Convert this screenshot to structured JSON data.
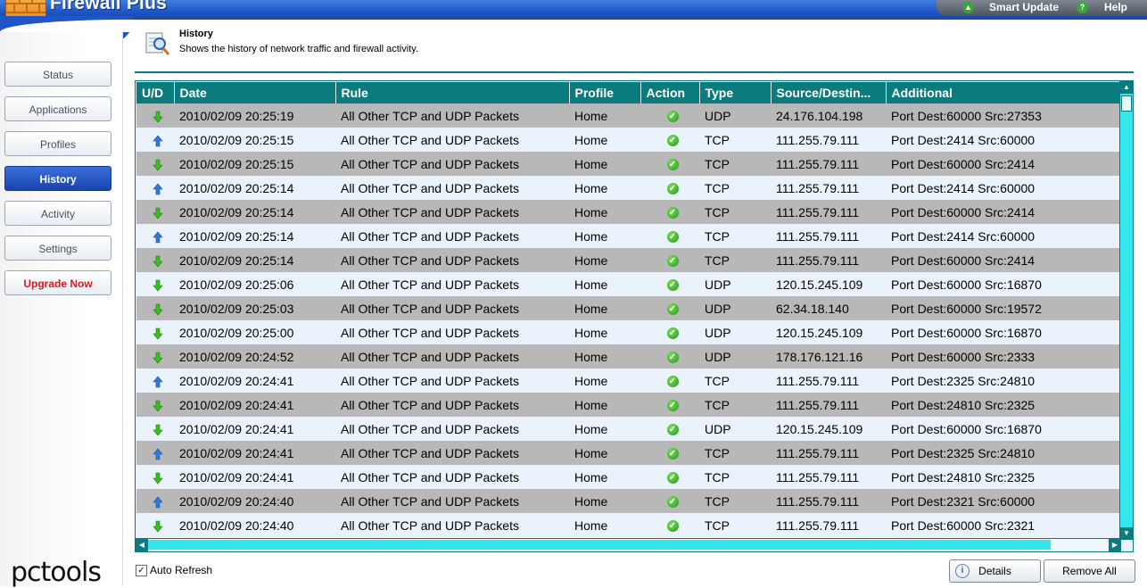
{
  "app": {
    "title": "Firewall Plus"
  },
  "topbar": {
    "smart_update": "Smart Update",
    "help": "Help"
  },
  "sidebar": {
    "items": [
      {
        "label": "Status"
      },
      {
        "label": "Applications"
      },
      {
        "label": "Profiles"
      },
      {
        "label": "History"
      },
      {
        "label": "Activity"
      },
      {
        "label": "Settings"
      },
      {
        "label": "Upgrade Now"
      }
    ],
    "active": "History",
    "brand": "pctools"
  },
  "header": {
    "title": "History",
    "subtitle": "Shows the history of network traffic and firewall activity."
  },
  "table": {
    "columns": [
      "U/D",
      "Date",
      "Rule",
      "Profile",
      "Action",
      "Type",
      "Source/Destin...",
      "Additional"
    ],
    "rows": [
      {
        "dir": "down",
        "date": "2010/02/09 20:25:19",
        "rule": "All Other TCP and UDP Packets",
        "profile": "Home",
        "type": "UDP",
        "addr": "24.176.104.198",
        "additional": "Port Dest:60000 Src:27353"
      },
      {
        "dir": "up",
        "date": "2010/02/09 20:25:15",
        "rule": "All Other TCP and UDP Packets",
        "profile": "Home",
        "type": "TCP",
        "addr": "111.255.79.111",
        "additional": "Port Dest:2414 Src:60000"
      },
      {
        "dir": "down",
        "date": "2010/02/09 20:25:15",
        "rule": "All Other TCP and UDP Packets",
        "profile": "Home",
        "type": "TCP",
        "addr": "111.255.79.111",
        "additional": "Port Dest:60000 Src:2414"
      },
      {
        "dir": "up",
        "date": "2010/02/09 20:25:14",
        "rule": "All Other TCP and UDP Packets",
        "profile": "Home",
        "type": "TCP",
        "addr": "111.255.79.111",
        "additional": "Port Dest:2414 Src:60000"
      },
      {
        "dir": "down",
        "date": "2010/02/09 20:25:14",
        "rule": "All Other TCP and UDP Packets",
        "profile": "Home",
        "type": "TCP",
        "addr": "111.255.79.111",
        "additional": "Port Dest:60000 Src:2414"
      },
      {
        "dir": "up",
        "date": "2010/02/09 20:25:14",
        "rule": "All Other TCP and UDP Packets",
        "profile": "Home",
        "type": "TCP",
        "addr": "111.255.79.111",
        "additional": "Port Dest:2414 Src:60000"
      },
      {
        "dir": "down",
        "date": "2010/02/09 20:25:14",
        "rule": "All Other TCP and UDP Packets",
        "profile": "Home",
        "type": "TCP",
        "addr": "111.255.79.111",
        "additional": "Port Dest:60000 Src:2414"
      },
      {
        "dir": "down",
        "date": "2010/02/09 20:25:06",
        "rule": "All Other TCP and UDP Packets",
        "profile": "Home",
        "type": "UDP",
        "addr": "120.15.245.109",
        "additional": "Port Dest:60000 Src:16870"
      },
      {
        "dir": "down",
        "date": "2010/02/09 20:25:03",
        "rule": "All Other TCP and UDP Packets",
        "profile": "Home",
        "type": "UDP",
        "addr": "62.34.18.140",
        "additional": "Port Dest:60000 Src:19572"
      },
      {
        "dir": "down",
        "date": "2010/02/09 20:25:00",
        "rule": "All Other TCP and UDP Packets",
        "profile": "Home",
        "type": "UDP",
        "addr": "120.15.245.109",
        "additional": "Port Dest:60000 Src:16870"
      },
      {
        "dir": "down",
        "date": "2010/02/09 20:24:52",
        "rule": "All Other TCP and UDP Packets",
        "profile": "Home",
        "type": "UDP",
        "addr": "178.176.121.16",
        "additional": "Port Dest:60000 Src:2333"
      },
      {
        "dir": "up",
        "date": "2010/02/09 20:24:41",
        "rule": "All Other TCP and UDP Packets",
        "profile": "Home",
        "type": "TCP",
        "addr": "111.255.79.111",
        "additional": "Port Dest:2325 Src:24810"
      },
      {
        "dir": "down",
        "date": "2010/02/09 20:24:41",
        "rule": "All Other TCP and UDP Packets",
        "profile": "Home",
        "type": "TCP",
        "addr": "111.255.79.111",
        "additional": "Port Dest:24810 Src:2325"
      },
      {
        "dir": "down",
        "date": "2010/02/09 20:24:41",
        "rule": "All Other TCP and UDP Packets",
        "profile": "Home",
        "type": "UDP",
        "addr": "120.15.245.109",
        "additional": "Port Dest:60000 Src:16870"
      },
      {
        "dir": "up",
        "date": "2010/02/09 20:24:41",
        "rule": "All Other TCP and UDP Packets",
        "profile": "Home",
        "type": "TCP",
        "addr": "111.255.79.111",
        "additional": "Port Dest:2325 Src:24810"
      },
      {
        "dir": "down",
        "date": "2010/02/09 20:24:41",
        "rule": "All Other TCP and UDP Packets",
        "profile": "Home",
        "type": "TCP",
        "addr": "111.255.79.111",
        "additional": "Port Dest:24810 Src:2325"
      },
      {
        "dir": "up",
        "date": "2010/02/09 20:24:40",
        "rule": "All Other TCP and UDP Packets",
        "profile": "Home",
        "type": "TCP",
        "addr": "111.255.79.111",
        "additional": "Port Dest:2321 Src:60000"
      },
      {
        "dir": "down",
        "date": "2010/02/09 20:24:40",
        "rule": "All Other TCP and UDP Packets",
        "profile": "Home",
        "type": "TCP",
        "addr": "111.255.79.111",
        "additional": "Port Dest:60000 Src:2321"
      }
    ]
  },
  "footer": {
    "auto_refresh_label": "Auto Refresh",
    "auto_refresh_checked": true,
    "details_label": "Details",
    "remove_all_label": "Remove All"
  },
  "colors": {
    "header_teal": "#0b7b7d",
    "row_gray": "#b8b8b8",
    "row_light": "#eaf3fb",
    "arrow_down_green": "#3bbf1c",
    "arrow_up_blue": "#2f7ad8",
    "action_ok_green": "#22941a",
    "upgrade_red": "#e0171f"
  }
}
